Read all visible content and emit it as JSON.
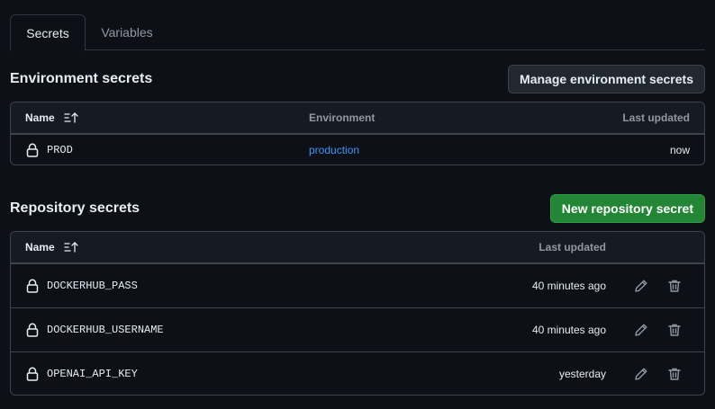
{
  "tabs": [
    {
      "label": "Secrets",
      "active": true
    },
    {
      "label": "Variables",
      "active": false
    }
  ],
  "environment_secrets": {
    "title": "Environment secrets",
    "manage_button": "Manage environment secrets",
    "columns": {
      "name": "Name",
      "environment": "Environment",
      "last_updated": "Last updated"
    },
    "rows": [
      {
        "name": "PROD",
        "environment": "production",
        "last_updated": "now"
      }
    ]
  },
  "repository_secrets": {
    "title": "Repository secrets",
    "new_button": "New repository secret",
    "columns": {
      "name": "Name",
      "last_updated": "Last updated"
    },
    "rows": [
      {
        "name": "DOCKERHUB_PASS",
        "last_updated": "40 minutes ago"
      },
      {
        "name": "DOCKERHUB_USERNAME",
        "last_updated": "40 minutes ago"
      },
      {
        "name": "OPENAI_API_KEY",
        "last_updated": "yesterday"
      }
    ]
  },
  "colors": {
    "background": "#0d1117",
    "border": "#3d444d",
    "primary_button": "#238636",
    "link": "#4493f8"
  },
  "icons": [
    "lock-icon",
    "sort-icon",
    "pencil-icon",
    "trash-icon"
  ]
}
